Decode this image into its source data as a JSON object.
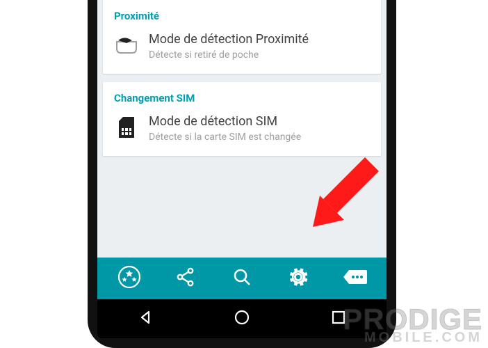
{
  "sections": {
    "proximity": {
      "header": "Proximité",
      "title": "Mode de détection Proximité",
      "subtitle": "Détecte si retiré de poche"
    },
    "sim": {
      "header": "Changement SIM",
      "title": "Mode de détection SIM",
      "subtitle": "Détecte si la carte SIM est changée"
    }
  },
  "colors": {
    "accent": "#009fb3",
    "toolbar": "#0097a7",
    "arrow": "#ff1a1a"
  },
  "watermark": {
    "line1": "PRODIGE",
    "line2": "MOBILE.COM"
  }
}
